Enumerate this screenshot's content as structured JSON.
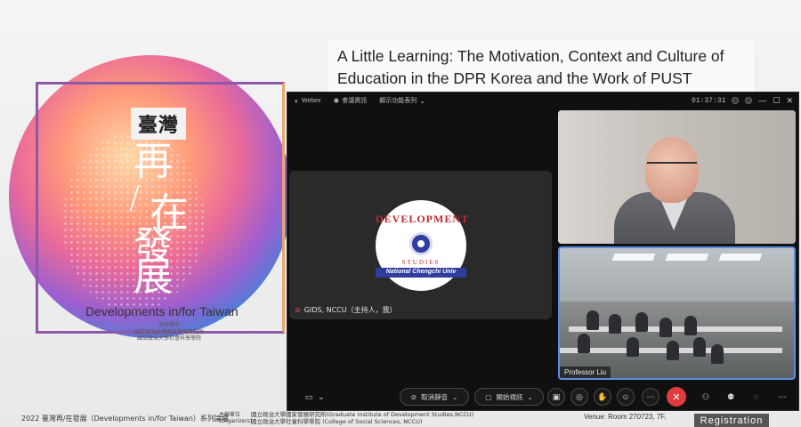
{
  "poster": {
    "title_box": "臺灣",
    "chars": [
      "再",
      "/",
      "在",
      "發",
      "展"
    ],
    "subtitle_en": "Developments in/for Taiwan",
    "org_lines": [
      "主辦單位",
      "國立政治大學國家發展研究所",
      "國立政治大學社會科學學院"
    ]
  },
  "talk": {
    "title": "A Little Learning: The Motivation, Context and Culture of Education in the DPR Korea and the Work of PUST"
  },
  "footer": {
    "series": "2022 臺灣再/在發展（Developments in/for Taiwan）系列論壇",
    "org_label_1": "主辦單位",
    "org_label_2": "(Organizers)",
    "org_1": "國立政治大學國家發展研究所(Graduate Institute of Development Studies,NCCU)",
    "org_2": "國立政治大學社會科學學院 (College of Social Sciences, NCCU)",
    "venue": "Venue: Room 270723, 7F,",
    "registration": "Registration"
  },
  "webex": {
    "app_name": "Webex",
    "menu_meeting": "會議資訊",
    "menu_hide": "顯示功能表列",
    "time": "01:37:31",
    "host": {
      "name": "GIDS, NCCU（主持人，我）",
      "logo_top": "DEVELOPMENT",
      "logo_studies": "STUDIES",
      "logo_bottom": "National Chengchi Univ"
    },
    "participant_label": "Professor Liu",
    "controls": {
      "unmute": "取消靜音",
      "start_video": "開始視訊"
    },
    "colors": {
      "end_call": "#e23b3f",
      "active_tile_border": "#5b8ee0"
    }
  }
}
